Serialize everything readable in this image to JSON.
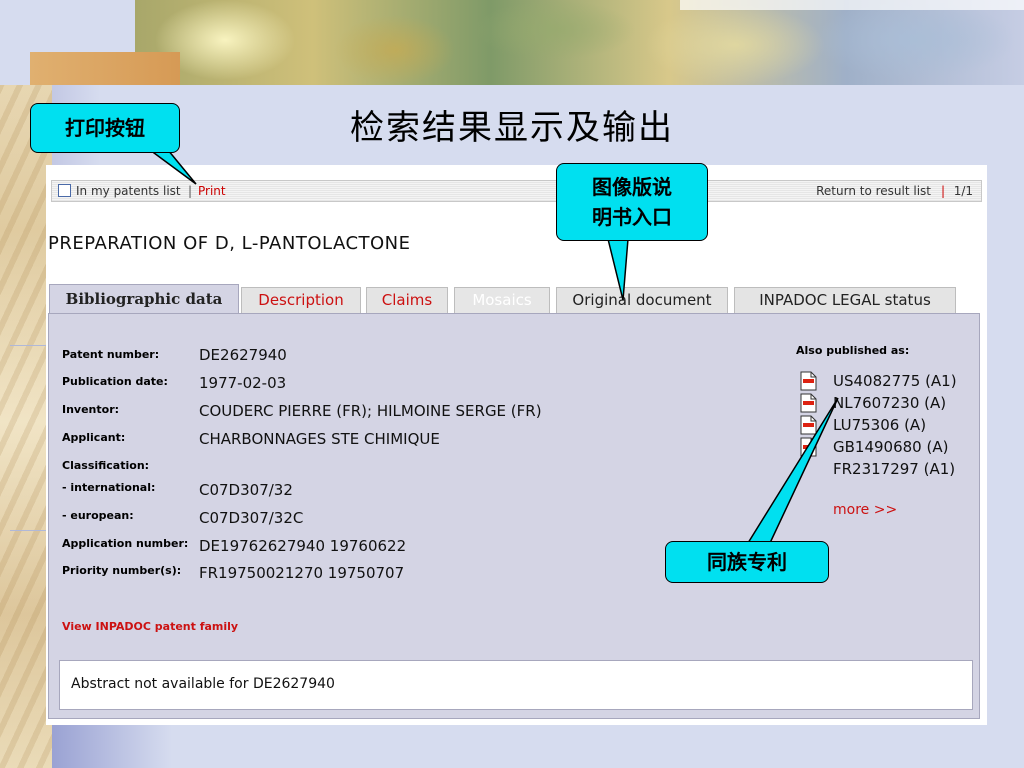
{
  "slide": {
    "title": "检索结果显示及输出"
  },
  "callouts": {
    "print_button": "打印按钮",
    "image_spec_line1": "图像版说",
    "image_spec_line2": "明书入口",
    "patent_family": "同族专利"
  },
  "toolbar": {
    "my_patents_list": "In my patents list",
    "sep": "|",
    "print": "Print",
    "return_to_result": "Return to result list",
    "page": "1/1"
  },
  "document": {
    "title": "PREPARATION OF D, L-PANTOLACTONE"
  },
  "tabs": [
    {
      "label": "Bibliographic data"
    },
    {
      "label": "Description"
    },
    {
      "label": "Claims"
    },
    {
      "label": "Mosaics"
    },
    {
      "label": "Original document"
    },
    {
      "label": "INPADOC LEGAL status"
    }
  ],
  "biblio": {
    "patent_number_label": "Patent number:",
    "patent_number": "DE2627940",
    "publication_date_label": "Publication date:",
    "publication_date": "1977-02-03",
    "inventor_label": "Inventor:",
    "inventor": "COUDERC PIERRE (FR); HILMOINE SERGE (FR)",
    "applicant_label": "Applicant:",
    "applicant": "CHARBONNAGES STE CHIMIQUE",
    "classification_label": "Classification:",
    "international_label": "- international:",
    "international": "C07D307/32",
    "european_label": "- european:",
    "european": "C07D307/32C",
    "application_number_label": "Application number:",
    "application_number": "DE19762627940 19760622",
    "priority_number_label": "Priority number(s):",
    "priority_number": "FR19750021270 19750707",
    "view_inpadoc": "View INPADOC patent family"
  },
  "also_published": {
    "label": "Also published as:",
    "items": [
      "US4082775 (A1)",
      "NL7607230 (A)",
      "LU75306 (A)",
      "GB1490680 (A)",
      "FR2317297 (A1)"
    ],
    "more": "more >>"
  },
  "abstract": {
    "text": "Abstract not available for DE2627940"
  }
}
